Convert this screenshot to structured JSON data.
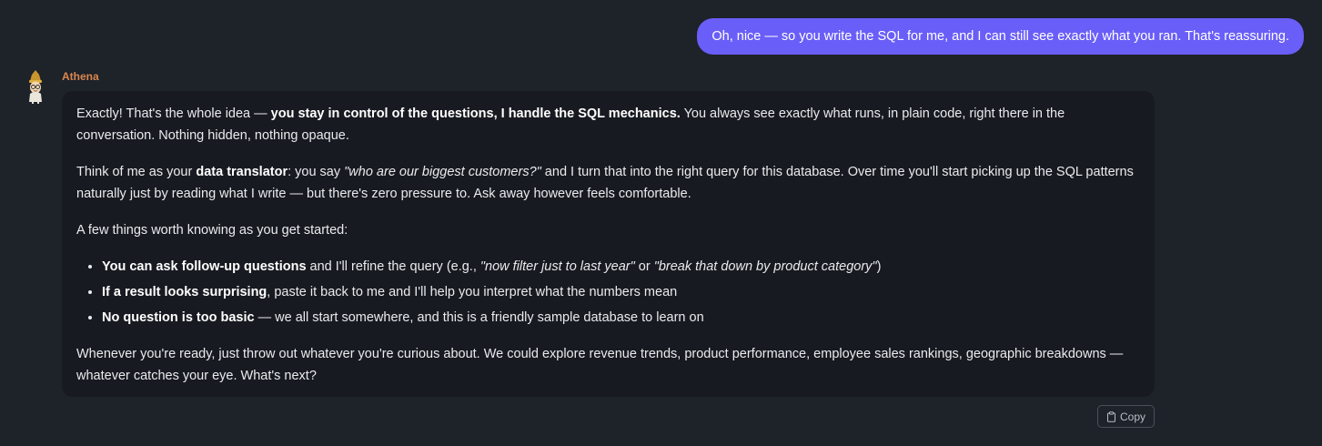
{
  "user_message": {
    "text": "Oh, nice — so you write the SQL for me, and I can still see exactly what you ran. That's reassuring."
  },
  "assistant": {
    "name": "Athena",
    "avatar_icon": "athena-avatar-icon",
    "p1": {
      "t1": "Exactly! That's the whole idea — ",
      "b1": "you stay in control of the questions, I handle the SQL mechanics.",
      "t2": " You always see exactly what runs, in plain code, right there in the conversation. Nothing hidden, nothing opaque."
    },
    "p2": {
      "t1": "Think of me as your ",
      "b1": "data translator",
      "t2": ": you say ",
      "i1": "\"who are our biggest customers?\"",
      "t3": " and I turn that into the right query for this database. Over time you'll start picking up the SQL patterns naturally just by reading what I write — but there's zero pressure to. Ask away however feels comfortable."
    },
    "p3": "A few things worth knowing as you get started:",
    "list": [
      {
        "b": "You can ask follow-up questions",
        "t1": " and I'll refine the query (e.g., ",
        "i1": "\"now filter just to last year\"",
        "t2": " or ",
        "i2": "\"break that down by product category\"",
        "t3": ")"
      },
      {
        "b": "If a result looks surprising",
        "t1": ", paste it back to me and I'll help you interpret what the numbers mean"
      },
      {
        "b": "No question is too basic",
        "t1": " — we all start somewhere, and this is a friendly sample database to learn on"
      }
    ],
    "p4": "Whenever you're ready, just throw out whatever you're curious about. We could explore revenue trends, product performance, employee sales rankings, geographic breakdowns — whatever catches your eye. What's next?"
  },
  "actions": {
    "copy_label": "Copy",
    "copy_icon": "clipboard-icon"
  },
  "colors": {
    "background": "#1e2229",
    "user_bubble": "#6a5ef8",
    "assistant_bubble": "#171a20",
    "sender_name": "#d9874f"
  }
}
